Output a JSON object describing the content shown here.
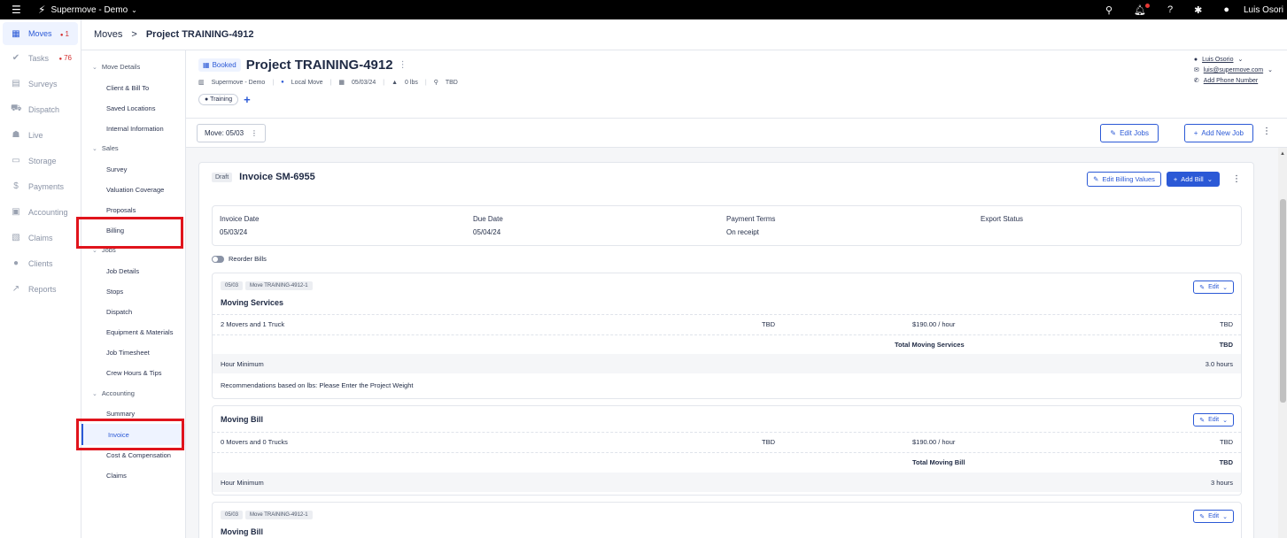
{
  "topbar": {
    "org": "Supermove - Demo",
    "user": "Luis Osori"
  },
  "nav": [
    {
      "label": "Moves",
      "icon": "calendar-icon",
      "badge": "1",
      "active": true
    },
    {
      "label": "Tasks",
      "icon": "check-circle-icon",
      "badge": "76"
    },
    {
      "label": "Surveys",
      "icon": "clipboard-icon"
    },
    {
      "label": "Dispatch",
      "icon": "truck-icon"
    },
    {
      "label": "Live",
      "icon": "people-icon"
    },
    {
      "label": "Storage",
      "icon": "storage-icon"
    },
    {
      "label": "Payments",
      "icon": "dollar-icon"
    },
    {
      "label": "Accounting",
      "icon": "calculator-icon"
    },
    {
      "label": "Claims",
      "icon": "claims-icon"
    },
    {
      "label": "Clients",
      "icon": "user-icon"
    },
    {
      "label": "Reports",
      "icon": "chart-icon"
    }
  ],
  "breadcrumb": {
    "root": "Moves",
    "sep": ">",
    "current": "Project TRAINING-4912"
  },
  "subnav": {
    "sections": [
      {
        "label": "Move Details",
        "items": [
          "Client & Bill To",
          "Saved Locations",
          "Internal Information"
        ]
      },
      {
        "label": "Sales",
        "items": [
          "Survey",
          "Valuation Coverage",
          "Proposals",
          "Billing"
        ]
      },
      {
        "label": "Jobs",
        "items": [
          "Job Details",
          "Stops",
          "Dispatch",
          "Equipment & Materials",
          "Job Timesheet",
          "Crew Hours & Tips"
        ]
      },
      {
        "label": "Accounting",
        "items": [
          "Summary",
          "Invoice",
          "Cost & Compensation",
          "Claims"
        ]
      }
    ]
  },
  "project": {
    "status": "Booked",
    "title": "Project TRAINING-4912",
    "org": "Supermove - Demo",
    "move_type": "Local Move",
    "date": "05/03/24",
    "weight": "0 lbs",
    "location": "TBD",
    "tag": "Training"
  },
  "contact": {
    "name": "Luis Osorio",
    "email": "luis@supermove.com",
    "phone": "Add Phone Number"
  },
  "movebar": {
    "move_label": "Move: 05/03",
    "edit_jobs": "Edit Jobs",
    "add_job": "Add New Job"
  },
  "invoice": {
    "status": "Draft",
    "title": "Invoice SM-6955",
    "edit_billing": "Edit Billing Values",
    "add_bill": "Add Bill",
    "fields": [
      {
        "label": "Invoice Date",
        "value": "05/03/24"
      },
      {
        "label": "Due Date",
        "value": "05/04/24"
      },
      {
        "label": "Payment Terms",
        "value": "On receipt"
      },
      {
        "label": "Export Status",
        "value": ""
      }
    ],
    "reorder": "Reorder Bills",
    "edit_label": "Edit"
  },
  "bills": [
    {
      "pills": [
        "05/03",
        "Move TRAINING-4912-1"
      ],
      "title": "Moving Services",
      "lines": [
        {
          "name": "2 Movers and 1 Truck",
          "qty": "TBD",
          "rate": "$190.00 / hour",
          "total": "TBD"
        },
        {
          "name": "",
          "qty": "",
          "rate": "Total Moving Services",
          "total": "TBD"
        },
        {
          "name": "Hour Minimum",
          "qty": "",
          "rate": "",
          "total": "3.0 hours"
        },
        {
          "name": "Recommendations based on lbs: Please Enter the Project Weight",
          "qty": "",
          "rate": "",
          "total": ""
        }
      ]
    },
    {
      "pills": [],
      "title": "Moving Bill",
      "lines": [
        {
          "name": "0 Movers and 0 Trucks",
          "qty": "TBD",
          "rate": "$190.00 / hour",
          "total": "TBD"
        },
        {
          "name": "",
          "qty": "",
          "rate": "Total Moving Bill",
          "total": "TBD"
        },
        {
          "name": "Hour Minimum",
          "qty": "",
          "rate": "",
          "total": "3 hours"
        }
      ]
    },
    {
      "pills": [
        "05/03",
        "Move TRAINING-4912-1"
      ],
      "title": "Moving Bill",
      "lines": []
    }
  ]
}
